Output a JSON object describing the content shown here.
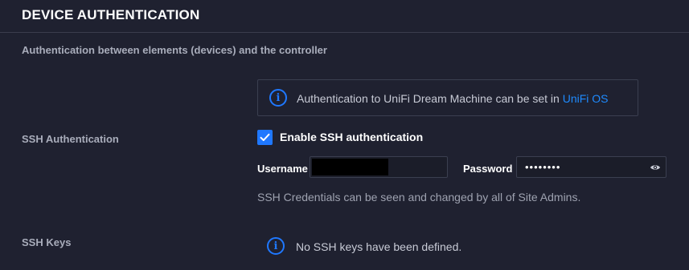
{
  "section": {
    "title": "DEVICE AUTHENTICATION",
    "subtitle": "Authentication between elements (devices) and the controller"
  },
  "notice": {
    "text": "Authentication to UniFi Dream Machine can be set in",
    "link_label": "UniFi OS",
    "icon": "info-icon"
  },
  "ssh_auth": {
    "label": "SSH Authentication",
    "enable_label": "Enable SSH authentication",
    "enabled": true,
    "username_label": "Username",
    "username_value": "",
    "password_label": "Password",
    "password_value": "••••••••",
    "help_text": "SSH Credentials can be seen and changed by all of Site Admins."
  },
  "ssh_keys": {
    "label": "SSH Keys",
    "empty_text": "No SSH keys have been defined.",
    "icon": "info-icon"
  },
  "colors": {
    "background": "#1f2130",
    "accent": "#1f78ff",
    "border": "#3b3f50"
  }
}
